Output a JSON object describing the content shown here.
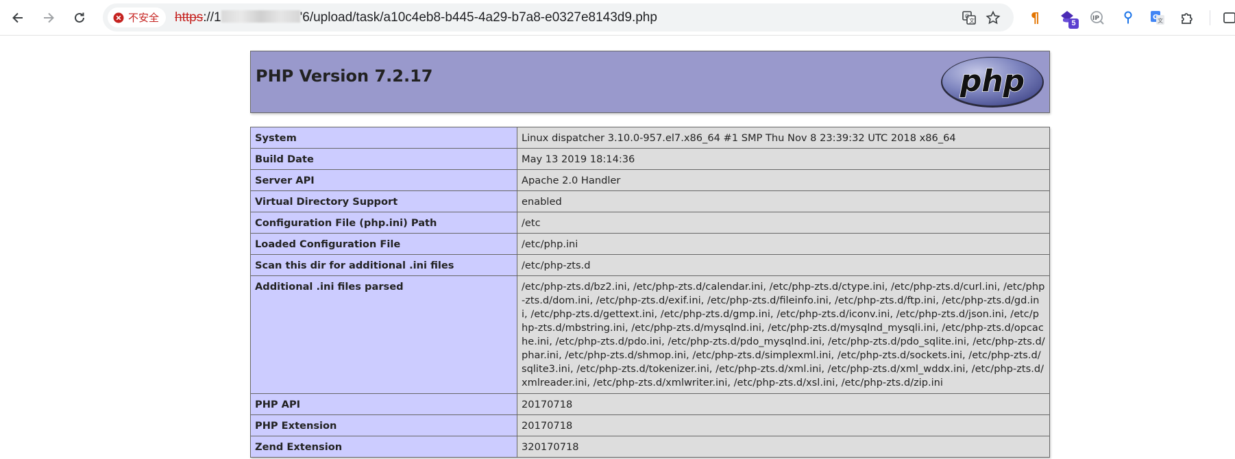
{
  "browser": {
    "security_label": "不安全",
    "url_scheme": "https",
    "url_sep": "://",
    "url_prefix": "1",
    "url_path": "'6/upload/task/a10c4eb8-b445-4a29-b7a8-e0327e8143d9.php",
    "extension_badge": "5",
    "icons": [
      "back-icon",
      "forward-icon",
      "reload-icon",
      "not-secure-icon",
      "translate-icon",
      "star-icon",
      "pilcrow-icon",
      "extension-icon",
      "ip-icon",
      "location-pin-icon",
      "google-translate-icon",
      "puzzle-icon",
      "sidebar-icon"
    ]
  },
  "php": {
    "title": "PHP Version 7.2.17",
    "logo_text": "php",
    "rows": [
      {
        "k": "System",
        "v": "Linux dispatcher 3.10.0-957.el7.x86_64 #1 SMP Thu Nov 8 23:39:32 UTC 2018 x86_64"
      },
      {
        "k": "Build Date",
        "v": "May 13 2019 18:14:36"
      },
      {
        "k": "Server API",
        "v": "Apache 2.0 Handler"
      },
      {
        "k": "Virtual Directory Support",
        "v": "enabled"
      },
      {
        "k": "Configuration File (php.ini) Path",
        "v": "/etc"
      },
      {
        "k": "Loaded Configuration File",
        "v": "/etc/php.ini"
      },
      {
        "k": "Scan this dir for additional .ini files",
        "v": "/etc/php-zts.d"
      },
      {
        "k": "Additional .ini files parsed",
        "v": "/etc/php-zts.d/bz2.ini, /etc/php-zts.d/calendar.ini, /etc/php-zts.d/ctype.ini, /etc/php-zts.d/curl.ini, /etc/php-zts.d/dom.ini, /etc/php-zts.d/exif.ini, /etc/php-zts.d/fileinfo.ini, /etc/php-zts.d/ftp.ini, /etc/php-zts.d/gd.ini, /etc/php-zts.d/gettext.ini, /etc/php-zts.d/gmp.ini, /etc/php-zts.d/iconv.ini, /etc/php-zts.d/json.ini, /etc/php-zts.d/mbstring.ini, /etc/php-zts.d/mysqlnd.ini, /etc/php-zts.d/mysqlnd_mysqli.ini, /etc/php-zts.d/opcache.ini, /etc/php-zts.d/pdo.ini, /etc/php-zts.d/pdo_mysqlnd.ini, /etc/php-zts.d/pdo_sqlite.ini, /etc/php-zts.d/phar.ini, /etc/php-zts.d/shmop.ini, /etc/php-zts.d/simplexml.ini, /etc/php-zts.d/sockets.ini, /etc/php-zts.d/sqlite3.ini, /etc/php-zts.d/tokenizer.ini, /etc/php-zts.d/xml.ini, /etc/php-zts.d/xml_wddx.ini, /etc/php-zts.d/xmlreader.ini, /etc/php-zts.d/xmlwriter.ini, /etc/php-zts.d/xsl.ini, /etc/php-zts.d/zip.ini"
      },
      {
        "k": "PHP API",
        "v": "20170718"
      },
      {
        "k": "PHP Extension",
        "v": "20170718"
      },
      {
        "k": "Zend Extension",
        "v": "320170718"
      }
    ]
  },
  "colors": {
    "header_bg": "#9999cc",
    "key_bg": "#ccccff",
    "value_bg": "#dddddd",
    "insecure_red": "#c5221f"
  }
}
